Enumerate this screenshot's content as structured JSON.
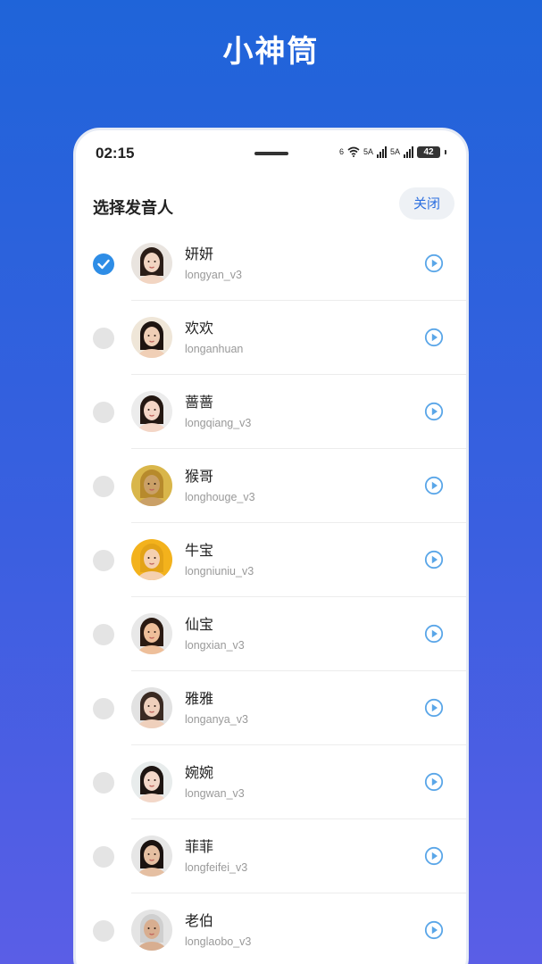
{
  "app": {
    "title": "小神筒"
  },
  "status_bar": {
    "time": "02:15",
    "network_1": "6",
    "network_2": "5A",
    "network_3": "5A",
    "battery": "42"
  },
  "sheet": {
    "title": "选择发音人",
    "close_label": "关闭"
  },
  "colors": {
    "accent": "#2e8de6",
    "play": "#5aa6e8"
  },
  "voices": [
    {
      "name": "妍妍",
      "id": "longyan_v3",
      "selected": true,
      "avatar_bg": "#e9e4df",
      "skin": "#f2d5c2",
      "hair": "#2b1d17"
    },
    {
      "name": "欢欢",
      "id": "longanhuan",
      "selected": false,
      "avatar_bg": "#efe6d8",
      "skin": "#f0cfb6",
      "hair": "#1e1410"
    },
    {
      "name": "蔷蔷",
      "id": "longqiang_v3",
      "selected": false,
      "avatar_bg": "#ececec",
      "skin": "#f4d6c6",
      "hair": "#241812"
    },
    {
      "name": "猴哥",
      "id": "longhouge_v3",
      "selected": false,
      "avatar_bg": "#d9b64a",
      "skin": "#caa067",
      "hair": "#b78a2c"
    },
    {
      "name": "牛宝",
      "id": "longniuniu_v3",
      "selected": false,
      "avatar_bg": "#f3b21c",
      "skin": "#f5d0b0",
      "hair": "#e3a317"
    },
    {
      "name": "仙宝",
      "id": "longxian_v3",
      "selected": false,
      "avatar_bg": "#e8e8e8",
      "skin": "#eebf9a",
      "hair": "#2a1a12"
    },
    {
      "name": "雅雅",
      "id": "longanya_v3",
      "selected": false,
      "avatar_bg": "#e2e2e2",
      "skin": "#efd0bc",
      "hair": "#3a2a22"
    },
    {
      "name": "婉婉",
      "id": "longwan_v3",
      "selected": false,
      "avatar_bg": "#e8ecec",
      "skin": "#f3d7c8",
      "hair": "#1e1512"
    },
    {
      "name": "菲菲",
      "id": "longfeifei_v3",
      "selected": false,
      "avatar_bg": "#e6e6e6",
      "skin": "#e5bfa2",
      "hair": "#1a1210"
    },
    {
      "name": "老伯",
      "id": "longlaobo_v3",
      "selected": false,
      "avatar_bg": "#e4e4e4",
      "skin": "#d8ae90",
      "hair": "#cfcfcf"
    }
  ]
}
